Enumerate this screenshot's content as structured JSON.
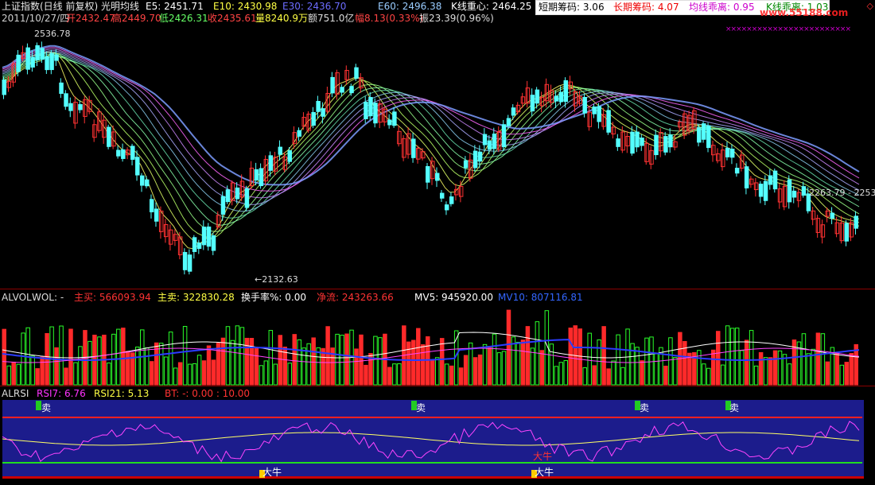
{
  "header": {
    "index_name": "上证指数(日线 前复权) 光明均线",
    "e5": "E5: 2451.71",
    "e10": "E10: 2430.98",
    "e30": "E30: 2436.70",
    "e60": "E60: 2496.38",
    "kline_center": "K线重心: 2464.25",
    "date_line": "2011/10/27/四",
    "open": "开2432.47",
    "high": "高2449.70",
    "low": "低2426.31",
    "close": "收2435.61",
    "volume": "量8240.9万",
    "amount": "额751.0亿",
    "change": "幅8.13(0.33%)",
    "amplitude": "振23.39(0.96%)"
  },
  "chip_box": {
    "short": "短期筹码: 3.06",
    "long": "长期筹码: 4.07",
    "ma_dev": "均线乖离: 0.95",
    "k_dev": "K线乖离: 1.03",
    "watermark": "www.55188.com",
    "stars": "××××××××××××××××××××××××"
  },
  "annotations": {
    "high_mark": "2536.78",
    "low_mark": "←2132.63",
    "range_mark": "2263.79 - 2253"
  },
  "volume_panel": {
    "name": "ALVOL",
    "vol": "WOL: -",
    "buy": "主买: 566093.94",
    "sell": "主卖: 322830.28",
    "turnover": "换手率%: 0.00",
    "net": "净流: 243263.66",
    "mv5": "MV5: 945920.00",
    "mv10": "MV10: 807116.81"
  },
  "rsi_panel": {
    "name": "ALRSI",
    "rsi7": "RSI7: 6.76",
    "rsi21": "RSI21: 5.13",
    "bt": "BT: -: 0.00 : 10.00",
    "sell_label": "卖",
    "bull_label": "大牛",
    "bull2_label": "大牛",
    "mid_label": "大牛"
  },
  "colors": {
    "up": "#ff3232",
    "down": "#54ffff",
    "vol_up": "#ff2a2a",
    "vol_down": "#2aff2a",
    "rsi_bg": "#1c1c8c"
  }
}
